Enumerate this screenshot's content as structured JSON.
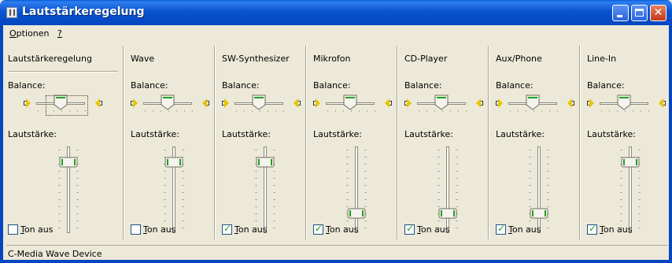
{
  "window": {
    "title": "Lautstärkeregelung"
  },
  "menu": [
    {
      "label": "Optionen",
      "accel_index": 0
    },
    {
      "label": "?",
      "accel_index": 0
    }
  ],
  "labels": {
    "balance": "Balance:",
    "volume": "Lautstärke:",
    "mute": "Ton aus"
  },
  "channels": [
    {
      "name": "Lautstärkeregelung",
      "balance": 0.5,
      "volume": 0.85,
      "muted": false,
      "master": true
    },
    {
      "name": "Wave",
      "balance": 0.5,
      "volume": 0.85,
      "muted": false
    },
    {
      "name": "SW-Synthesizer",
      "balance": 0.5,
      "volume": 0.85,
      "muted": true
    },
    {
      "name": "Mikrofon",
      "balance": 0.5,
      "volume": 0.2,
      "muted": true
    },
    {
      "name": "CD-Player",
      "balance": 0.5,
      "volume": 0.2,
      "muted": true
    },
    {
      "name": "Aux/Phone",
      "balance": 0.5,
      "volume": 0.2,
      "muted": true
    },
    {
      "name": "Line-In",
      "balance": 0.5,
      "volume": 0.85,
      "muted": true
    }
  ],
  "status": {
    "text": "C-Media Wave Device"
  },
  "colors": {
    "title_bar": "#0a54d0",
    "face": "#ece9d8",
    "check_mark": "#21a121",
    "speaker": "#e8c400"
  }
}
